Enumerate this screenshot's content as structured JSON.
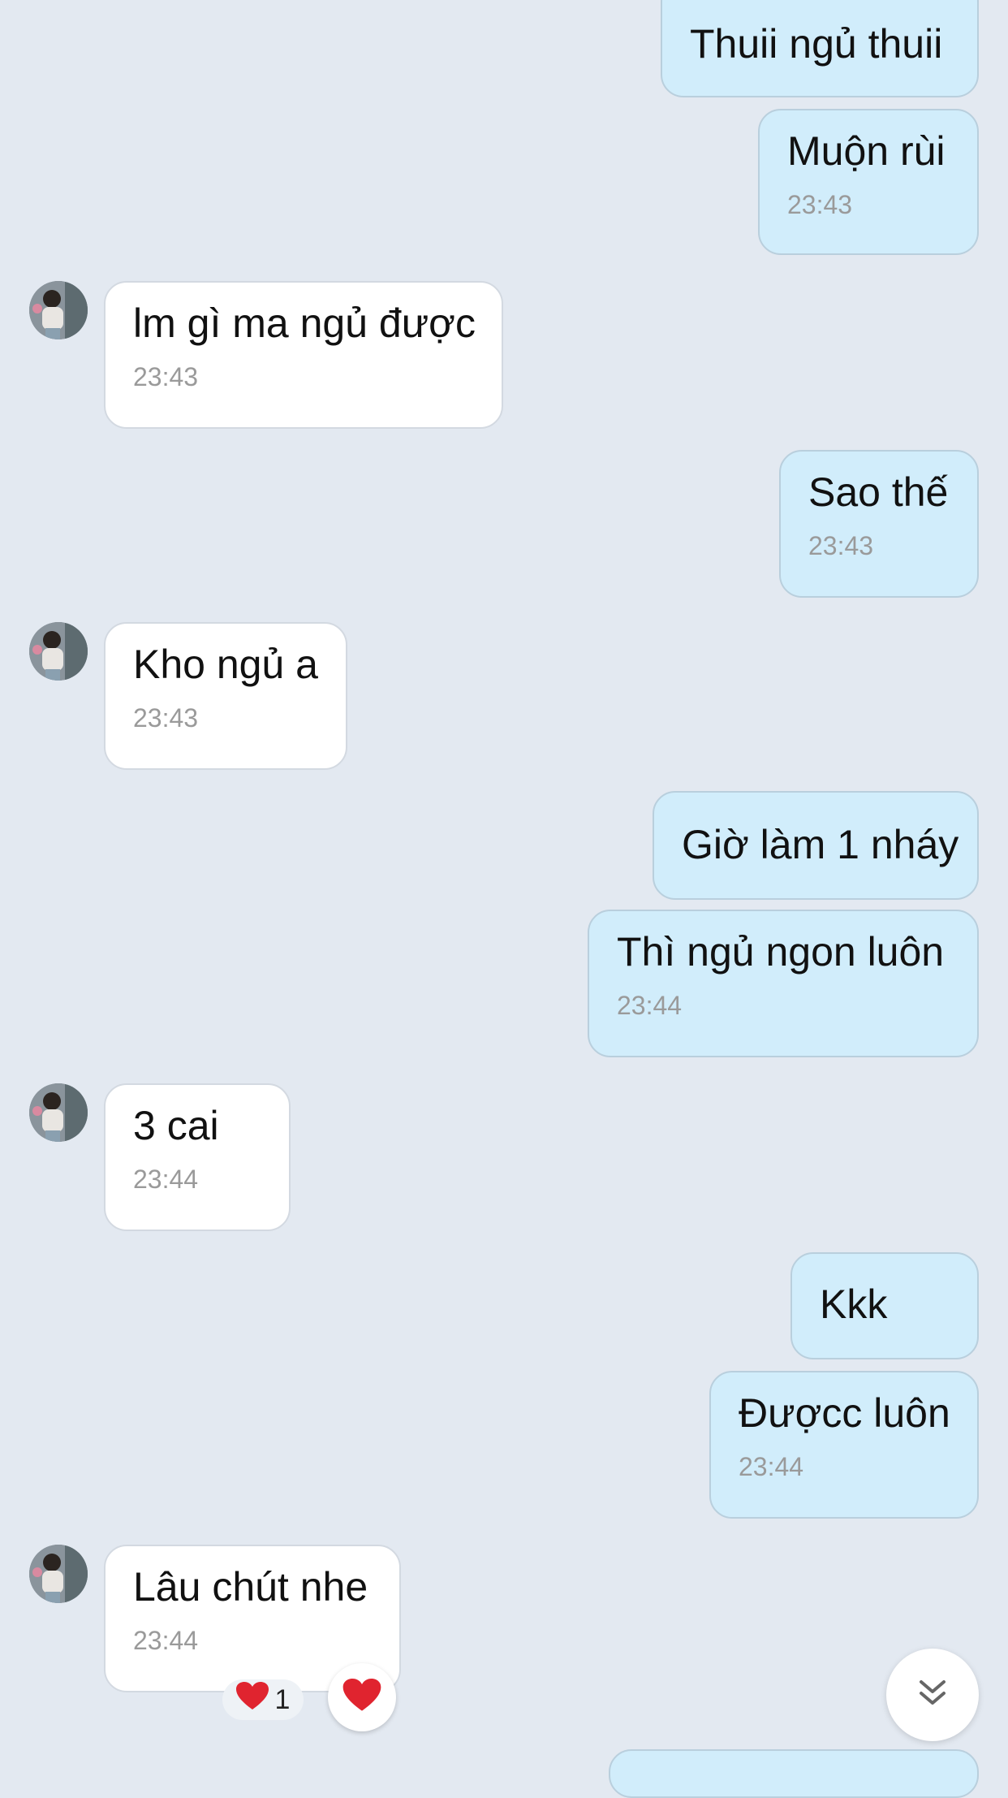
{
  "messages": [
    {
      "side": "mine",
      "text": "Thuii ngủ thuii",
      "time": ""
    },
    {
      "side": "mine",
      "text": "Muộn rùi",
      "time": "23:43"
    },
    {
      "side": "theirs",
      "text": "lm gì ma ngủ được",
      "time": "23:43"
    },
    {
      "side": "mine",
      "text": "Sao thế",
      "time": "23:43"
    },
    {
      "side": "theirs",
      "text": "Kho ngủ a",
      "time": "23:43"
    },
    {
      "side": "mine",
      "text": "Giờ làm 1 nháy",
      "time": ""
    },
    {
      "side": "mine",
      "text": "Thì ngủ ngon luôn",
      "time": "23:44"
    },
    {
      "side": "theirs",
      "text": "3 cai",
      "time": "23:44"
    },
    {
      "side": "mine",
      "text": "Kkk",
      "time": ""
    },
    {
      "side": "mine",
      "text": "Đượcc luôn",
      "time": "23:44"
    },
    {
      "side": "theirs",
      "text": "Lâu chút nhe",
      "time": "23:44"
    }
  ],
  "reaction": {
    "emoji": "heart",
    "count": "1"
  },
  "colors": {
    "background": "#e3e9f1",
    "mine_bubble": "#d1edfb",
    "theirs_bubble": "#ffffff",
    "heart": "#e0242f"
  },
  "icons": {
    "reaction_button": "heart-icon",
    "scroll_button": "double-chevron-down-icon"
  }
}
